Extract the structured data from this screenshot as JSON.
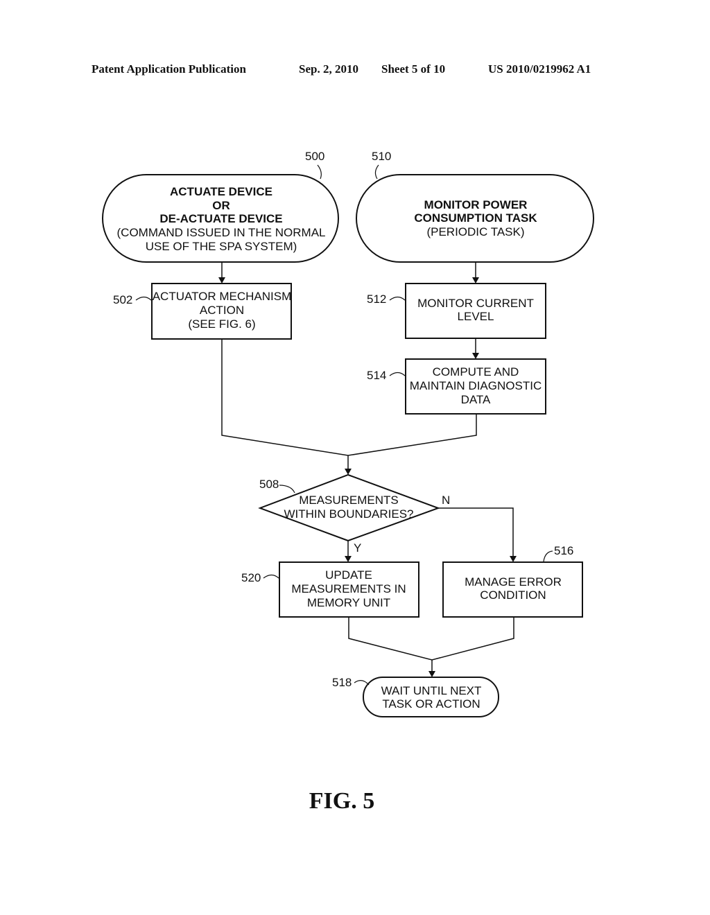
{
  "header": {
    "publication": "Patent Application Publication",
    "date": "Sep. 2, 2010",
    "sheet": "Sheet 5 of 10",
    "number": "US 2010/0219962 A1"
  },
  "figure_label": "FIG. 5",
  "nodes": {
    "n500": {
      "ref": "500",
      "type": "terminal",
      "lines_bold": [
        "ACTUATE DEVICE",
        "OR",
        "DE-ACTUATE DEVICE"
      ],
      "lines": [
        "(COMMAND ISSUED IN THE NORMAL",
        "USE OF THE SPA SYSTEM)"
      ]
    },
    "n510": {
      "ref": "510",
      "type": "terminal",
      "lines_bold": [
        "MONITOR POWER",
        "CONSUMPTION TASK"
      ],
      "lines": [
        "(PERIODIC TASK)"
      ]
    },
    "n502": {
      "ref": "502",
      "type": "process",
      "lines": [
        "ACTUATOR MECHANISM",
        "ACTION",
        "(SEE FIG. 6)"
      ]
    },
    "n512": {
      "ref": "512",
      "type": "process",
      "lines": [
        "MONITOR CURRENT",
        "LEVEL"
      ]
    },
    "n514": {
      "ref": "514",
      "type": "process",
      "lines": [
        "COMPUTE AND",
        "MAINTAIN DIAGNOSTIC",
        "DATA"
      ]
    },
    "n508": {
      "ref": "508",
      "type": "decision",
      "lines": [
        "MEASUREMENTS",
        "WITHIN BOUNDARIES?"
      ],
      "yes_label": "Y",
      "no_label": "N"
    },
    "n520": {
      "ref": "520",
      "type": "process",
      "lines": [
        "UPDATE",
        "MEASUREMENTS IN",
        "MEMORY UNIT"
      ]
    },
    "n516": {
      "ref": "516",
      "type": "process",
      "lines": [
        "MANAGE ERROR",
        "CONDITION"
      ]
    },
    "n518": {
      "ref": "518",
      "type": "terminal",
      "lines": [
        "WAIT UNTIL NEXT",
        "TASK OR ACTION"
      ]
    }
  }
}
